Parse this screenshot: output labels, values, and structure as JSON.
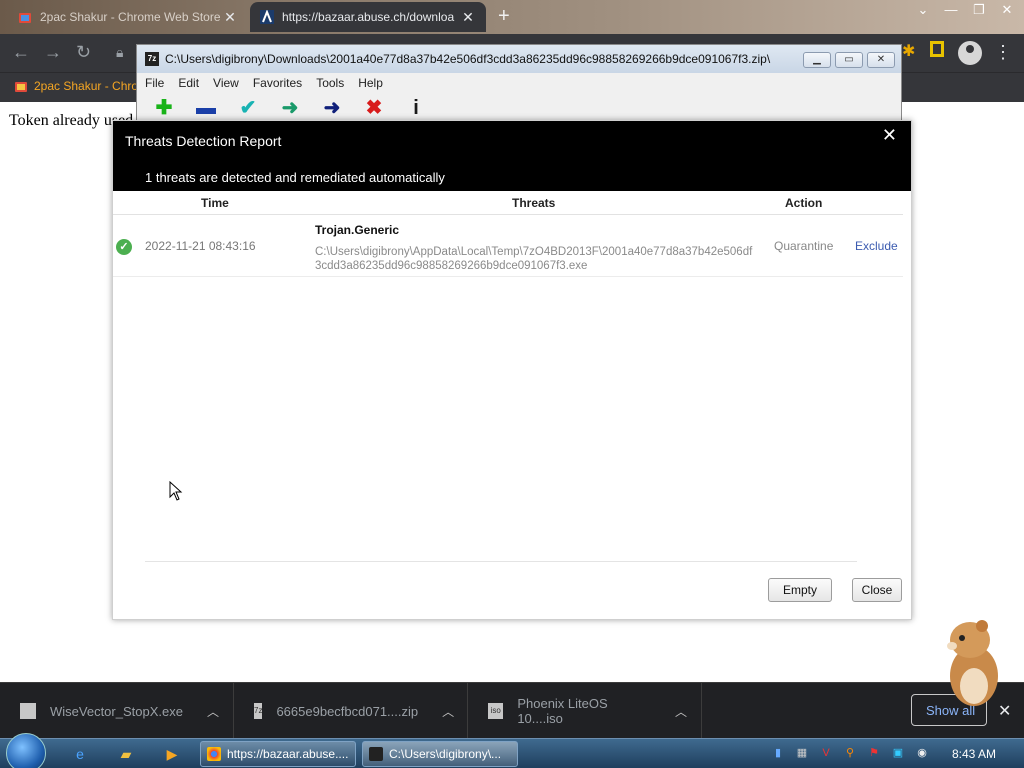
{
  "browser": {
    "tabs": [
      {
        "title": "2pac Shakur - Chrome Web Store",
        "active": false
      },
      {
        "title": "https://bazaar.abuse.ch/downloa",
        "active": true
      }
    ],
    "bookmark": "2pac Shakur - Chro",
    "page_text": "Token already used"
  },
  "sevenzip": {
    "title": "C:\\Users\\digibrony\\Downloads\\2001a40e77d8a37b42e506df3cdd3a86235dd96c98858269266b9dce091067f3.zip\\",
    "icon_text": "7z",
    "menu": [
      "File",
      "Edit",
      "View",
      "Favorites",
      "Tools",
      "Help"
    ],
    "tools": [
      "add-icon",
      "extract-icon",
      "test-icon",
      "copy-icon",
      "move-icon",
      "delete-icon",
      "info-icon"
    ],
    "tool_glyphs": [
      "✚",
      "▬",
      "✔",
      "➜",
      "➜",
      "✖",
      "i"
    ],
    "tool_colors": [
      "#19b319",
      "#1a3fa8",
      "#19b3b3",
      "#1a9a6a",
      "#10207a",
      "#d81b1b",
      "#1a1a1a"
    ]
  },
  "dialog": {
    "title": "Threats Detection Report",
    "subtitle": "1 threats are detected and remediated automatically",
    "close_glyph": "✕",
    "columns": {
      "time": "Time",
      "threats": "Threats",
      "action": "Action"
    },
    "rows": [
      {
        "time": "2022-11-21 08:43:16",
        "name": "Trojan.Generic",
        "path": "C:\\Users\\digibrony\\AppData\\Local\\Temp\\7zO4BD2013F\\2001a40e77d8a37b42e506df3cdd3a86235dd96c98858269266b9dce091067f3.exe",
        "action": "Quarantine",
        "exclude": "Exclude"
      }
    ],
    "buttons": {
      "empty": "Empty",
      "close": "Close"
    }
  },
  "downloads": {
    "items": [
      {
        "name": "WiseVector_StopX.exe"
      },
      {
        "name": "6665e9becfbcd071....zip"
      },
      {
        "name": "Phoenix LiteOS 10....iso"
      }
    ],
    "show_all": "Show all",
    "close_glyph": "✕"
  },
  "taskbar": {
    "tasks": [
      {
        "label": "https://bazaar.abuse...."
      },
      {
        "label": "C:\\Users\\digibrony\\..."
      }
    ],
    "clock": "8:43 AM"
  },
  "colors": {
    "dialog_header": "#000000",
    "exclude_link": "#3b5bb0",
    "check_green": "#4caf50",
    "chrome_dark": "#35363a"
  }
}
